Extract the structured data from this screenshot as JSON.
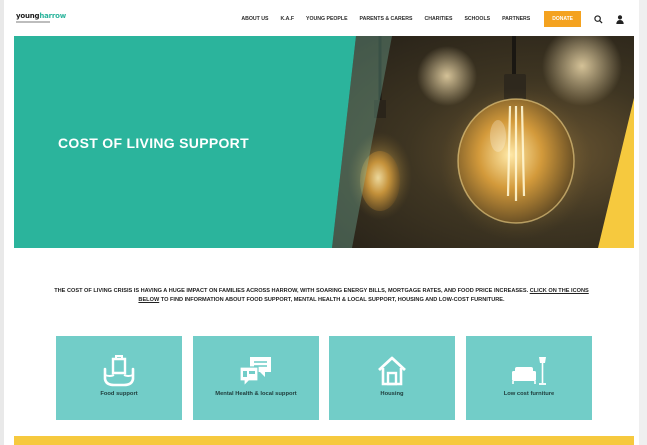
{
  "brand": {
    "logo_part1": "young",
    "logo_part2": "harrow"
  },
  "nav": {
    "items": [
      "ABOUT US",
      "K.A.F",
      "YOUNG PEOPLE",
      "PARENTS & CARERS",
      "CHARITIES",
      "SCHOOLS",
      "PARTNERS"
    ],
    "donate_label": "DONATE"
  },
  "hero": {
    "title": "COST OF LIVING SUPPORT"
  },
  "intro": {
    "part1": "THE COST OF LIVING CRISIS IS HAVING A HUGE IMPACT ON FAMILIES ACROSS HARROW, WITH SOARING ENERGY BILLS, MORTGAGE RATES, AND FOOD PRICE INCREASES. ",
    "link": "CLICK ON THE ICONS BELOW",
    "part2": " TO FIND INFORMATION ABOUT FOOD SUPPORT, MENTAL HEALTH & LOCAL SUPPORT, HOUSING AND LOW-COST FURNITURE."
  },
  "cards": [
    {
      "label": "Food support",
      "icon": "food-hands-icon"
    },
    {
      "label": "Mental Health & local support",
      "icon": "chat-bubbles-icon"
    },
    {
      "label": "Housing",
      "icon": "house-icon"
    },
    {
      "label": "Low cost furniture",
      "icon": "sofa-lamp-icon"
    }
  ],
  "colors": {
    "teal": "#2bb49c",
    "card_teal": "#72cdc8",
    "donate": "#f4a21f",
    "yellow": "#f6c93e"
  }
}
